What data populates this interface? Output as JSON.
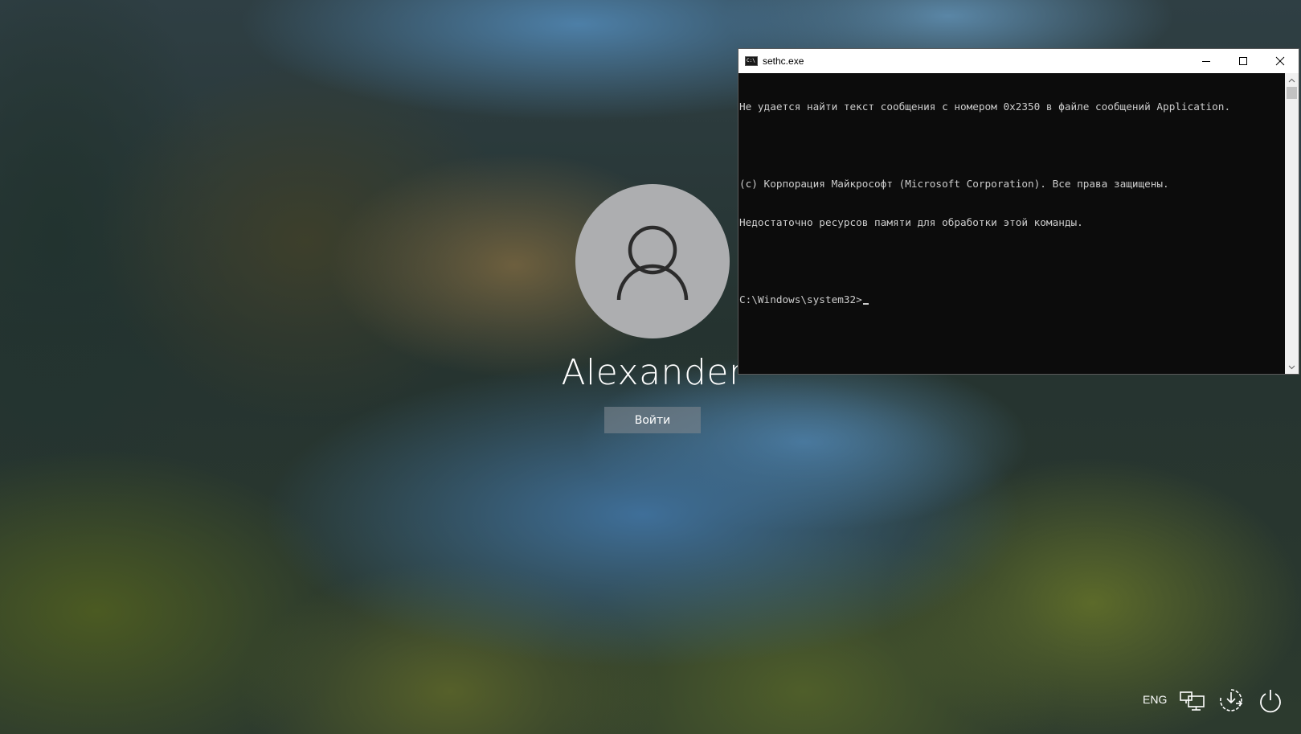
{
  "login": {
    "username": "Alexander",
    "signin_label": "Войти"
  },
  "cmd": {
    "title": "sethc.exe",
    "lines": [
      "Не удается найти текст сообщения с номером 0x2350 в файле сообщений Application.",
      "",
      "(c) Корпорация Майкрософт (Microsoft Corporation). Все права защищены.",
      "Недостаточно ресурсов памяти для обработки этой команды.",
      "",
      "C:\\Windows\\system32>"
    ]
  },
  "tray": {
    "language": "ENG",
    "icons": [
      "network-icon",
      "accessibility-icon",
      "power-icon"
    ]
  },
  "colors": {
    "console_bg": "#0c0c0c",
    "console_text": "#cccccc",
    "avatar_bg": "#adaeb0",
    "button_bg": "rgba(120,130,140,0.65)"
  }
}
